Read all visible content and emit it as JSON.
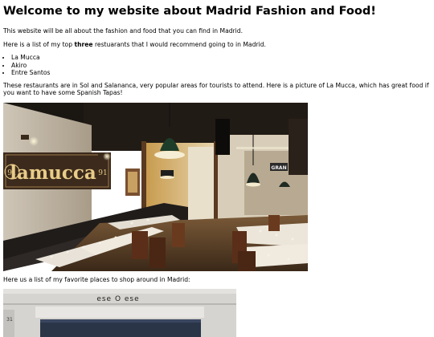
{
  "heading": "Welcome to my website about Madrid Fashion and Food!",
  "intro": "This website will be all about the fashion and food that you can find in Madrid.",
  "list_intro": {
    "before": "Here is a list of my top ",
    "emphasis": "three",
    "after": " restuarants that I would recommend going to in Madrid."
  },
  "restaurants": [
    "La Mucca",
    "Akiro",
    "Entre Santos"
  ],
  "description": "These restaurants are in Sol and Salananca, very popular areas for tourists to attend. Here is a picture of La Mucca, which has great food if you want to have some Spanish Tapas!",
  "photo": {
    "sign_text": "lamucca",
    "sign_number": "91",
    "sign_number_right": "91",
    "granja_text": "GRAN"
  },
  "shop_intro": "Here us a list of my favorite places to shop around in Madrid:",
  "shop_photo": {
    "sign_text": "ese O ese",
    "number_text": "31"
  }
}
